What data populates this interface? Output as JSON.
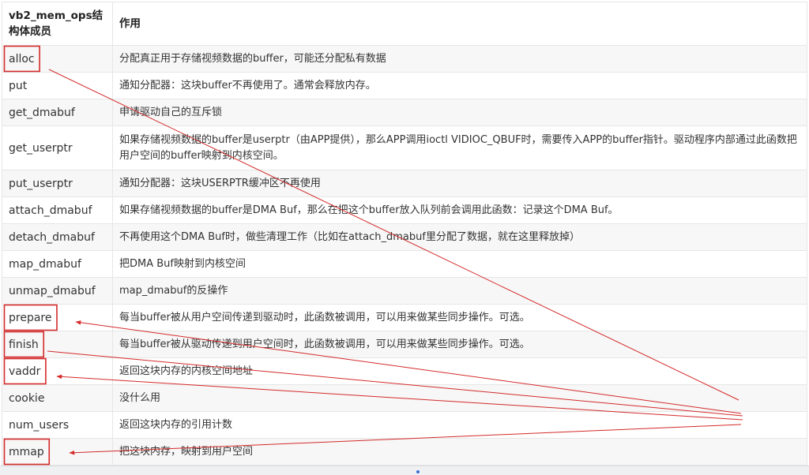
{
  "table": {
    "header": {
      "member": "vb2_mem_ops结构体成员",
      "purpose": "作用"
    },
    "rows": [
      {
        "member": "alloc",
        "desc": "分配真正用于存储视频数据的buffer，可能还分配私有数据",
        "highlighted": true
      },
      {
        "member": "put",
        "desc": "通知分配器：这块buffer不再使用了。通常会释放内存。",
        "highlighted": false
      },
      {
        "member": "get_dmabuf",
        "desc": "申请驱动自己的互斥锁",
        "highlighted": false
      },
      {
        "member": "get_userptr",
        "desc": "如果存储视频数据的buffer是userptr（由APP提供），那么APP调用ioctl VIDIOC_QBUF时，需要传入APP的buffer指针。驱动程序内部通过此函数把用户空间的buffer映射到内核空间。",
        "highlighted": false
      },
      {
        "member": "put_userptr",
        "desc": "通知分配器：这块USERPTR缓冲区不再使用",
        "highlighted": false
      },
      {
        "member": "attach_dmabuf",
        "desc": "如果存储视频数据的buffer是DMA Buf，那么在把这个buffer放入队列前会调用此函数：记录这个DMA Buf。",
        "highlighted": false
      },
      {
        "member": "detach_dmabuf",
        "desc": "不再使用这个DMA Buf时，做些清理工作（比如在attach_dmabuf里分配了数据，就在这里释放掉）",
        "highlighted": false
      },
      {
        "member": "map_dmabuf",
        "desc": "把DMA Buf映射到内核空间",
        "highlighted": false
      },
      {
        "member": "unmap_dmabuf",
        "desc": "map_dmabuf的反操作",
        "highlighted": false
      },
      {
        "member": "prepare",
        "desc": "每当buffer被从用户空间传递到驱动时，此函数被调用，可以用来做某些同步操作。可选。",
        "highlighted": true
      },
      {
        "member": "finish",
        "desc": "每当buffer被从驱动传递到用户空间时，此函数被调用，可以用来做某些同步操作。可选。",
        "highlighted": true
      },
      {
        "member": "vaddr",
        "desc": "返回这块内存的内核空间地址",
        "highlighted": true
      },
      {
        "member": "cookie",
        "desc": "没什么用",
        "highlighted": false
      },
      {
        "member": "num_users",
        "desc": "返回这块内存的引用计数",
        "highlighted": false
      },
      {
        "member": "mmap",
        "desc": "把这块内存，映射到用户空间",
        "highlighted": true
      }
    ]
  },
  "annotation": {
    "color": "#d42a2a"
  }
}
